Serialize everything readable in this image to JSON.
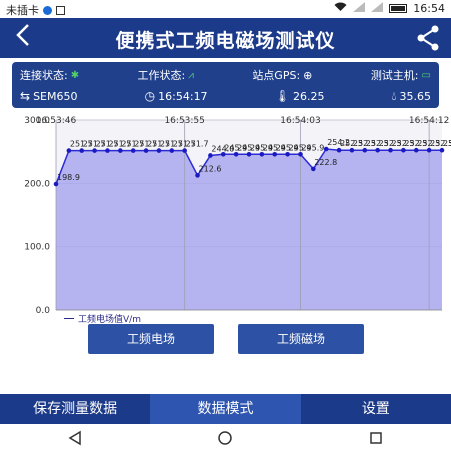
{
  "status_bar": {
    "carrier": "未插卡",
    "time": "16:54"
  },
  "header": {
    "title": "便携式工频电磁场测试仪"
  },
  "info": {
    "connection_label": "连接状态:",
    "work_label": "工作状态:",
    "gps_label": "站点GPS:",
    "host_label": "测试主机:",
    "device": "SEM650",
    "time": "16:54:17",
    "temperature": "26.25",
    "humidity": "35.65"
  },
  "chart_data": {
    "type": "area",
    "x_tick_labels": [
      "16:53:46",
      "16:53:55",
      "16:54:03",
      "16:54:12"
    ],
    "x_tick_positions": [
      0,
      10,
      19,
      29
    ],
    "y_ticks": [
      "300.0",
      "200.0",
      "100.0",
      "0.0"
    ],
    "ylim": [
      0,
      300
    ],
    "legend": "工频电场值V/m",
    "series": [
      {
        "name": "工频电场值V/m",
        "values": [
          198.9,
          251.7,
          251.7,
          251.7,
          251.7,
          251.7,
          251.7,
          251.7,
          251.7,
          251.7,
          251.7,
          212.6,
          244.0,
          245.9,
          245.9,
          245.9,
          245.9,
          245.9,
          245.9,
          245.9,
          222.8,
          254.2,
          252.3,
          252.3,
          252.3,
          252.3,
          252.3,
          252.3,
          252.3,
          252.3,
          252.3
        ],
        "labels": [
          "198.9",
          "251.7",
          "251.7",
          "251.7",
          "251.7",
          "251.7",
          "251.7",
          "251.7",
          "251.7",
          "251.7",
          "251.7",
          "212.6",
          "244.0",
          "245.9",
          "245.9",
          "245.9",
          "245.9",
          "245.9",
          "245.9",
          "245.9",
          "222.8",
          "254.2",
          "252.3",
          "252.3",
          "252.3",
          "252.3",
          "252.3",
          "252.3",
          "252.3",
          "252.3",
          "252.3"
        ]
      }
    ],
    "fill_color": "#a9a8ee",
    "line_color": "#2b2bd6",
    "grid": true
  },
  "buttons": {
    "electric": "工频电场",
    "magnetic": "工频磁场"
  },
  "tabs": [
    {
      "label": "保存测量数据"
    },
    {
      "label": "数据模式"
    },
    {
      "label": "设置"
    }
  ],
  "colors": {
    "primary": "#1c3a8a",
    "button": "#2d52a5",
    "active_tab": "#2e56b0",
    "status_green": "#52d16b"
  }
}
